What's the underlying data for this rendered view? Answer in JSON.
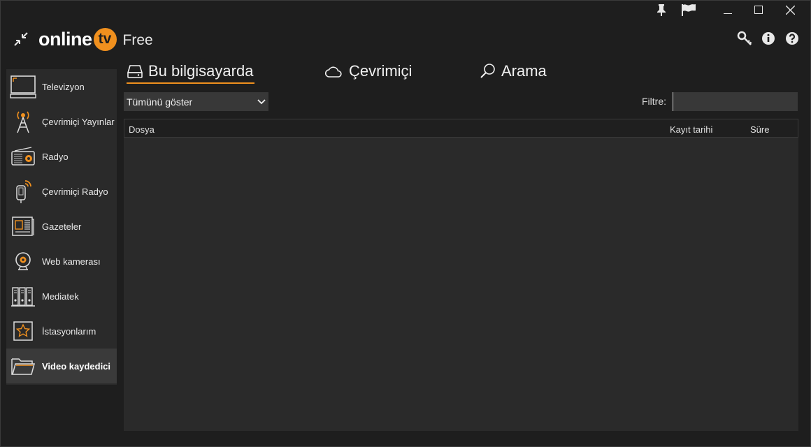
{
  "app": {
    "brand_name": "online",
    "brand_tv": "tv",
    "edition": "Free"
  },
  "window_controls": [
    "pin-icon",
    "flag-icon",
    "minimize-icon",
    "maximize-icon",
    "close-icon"
  ],
  "top_icons": [
    "key-icon",
    "info-icon",
    "help-icon"
  ],
  "sidebar": {
    "items": [
      {
        "label": "Televizyon",
        "icon": "tv-icon"
      },
      {
        "label": "Çevrimiçi Yayınlar",
        "icon": "broadcast-antenna-icon"
      },
      {
        "label": "Radyo",
        "icon": "radio-icon"
      },
      {
        "label": "Çevrimiçi Radyo",
        "icon": "mobile-radio-icon"
      },
      {
        "label": "Gazeteler",
        "icon": "newspaper-icon"
      },
      {
        "label": "Web kamerası",
        "icon": "webcam-icon"
      },
      {
        "label": "Mediatek",
        "icon": "media-library-icon"
      },
      {
        "label": "İstasyonlarım",
        "icon": "star-icon"
      },
      {
        "label": "Video kaydedici",
        "icon": "folder-icon",
        "active": true
      }
    ]
  },
  "tabs": [
    {
      "label": "Bu bilgisayarda",
      "icon": "hard-drive-icon",
      "active": true
    },
    {
      "label": "Çevrimiçi",
      "icon": "cloud-icon"
    },
    {
      "label": "Arama",
      "icon": "search-icon"
    }
  ],
  "filter": {
    "show_select_value": "Tümünü göster",
    "label": "Filtre:",
    "value": ""
  },
  "table": {
    "columns": [
      "Dosya",
      "Kayıt tarihi",
      "Süre"
    ],
    "rows": []
  },
  "colors": {
    "accent": "#f0901e",
    "background": "#1e1e1e",
    "panel": "#2a2a2a"
  }
}
